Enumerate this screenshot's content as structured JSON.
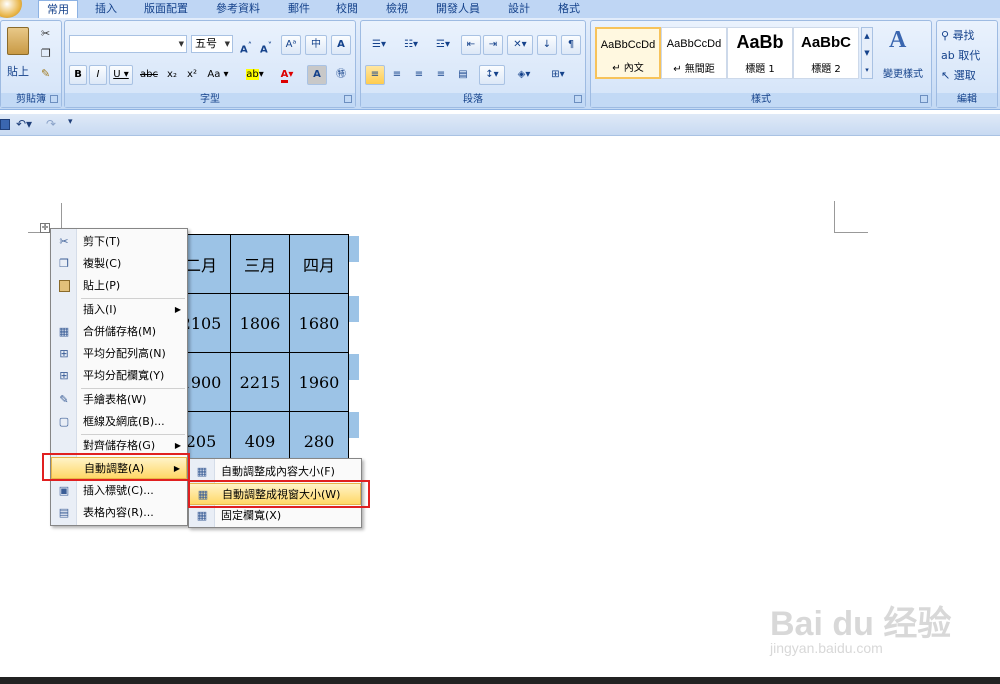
{
  "tabs": [
    "常用",
    "插入",
    "版面配置",
    "參考資料",
    "郵件",
    "校閱",
    "檢視",
    "開發人員",
    "設計",
    "格式"
  ],
  "ribbon": {
    "clipboard": {
      "group": "剪貼簿",
      "paste": "貼上"
    },
    "font": {
      "group": "字型",
      "name_value": "",
      "size_value": "五号"
    },
    "paragraph": {
      "group": "段落"
    },
    "styles": {
      "group": "樣式",
      "items": [
        {
          "preview": "AaBbCcDd",
          "name": "↵ 內文"
        },
        {
          "preview": "AaBbCcDd",
          "name": "↵ 無間距"
        },
        {
          "preview": "AaBb",
          "name": "標題 1"
        },
        {
          "preview": "AaBbC",
          "name": "標題 2"
        }
      ],
      "change_styles": "變更樣式"
    },
    "editing": {
      "group": "編輯",
      "find": "尋找",
      "replace": "取代",
      "select": "選取"
    }
  },
  "table": {
    "headers": [
      "二月",
      "三月",
      "四月"
    ],
    "rows": [
      [
        "2105",
        "1806",
        "1680"
      ],
      [
        "1900",
        "2215",
        "1960"
      ],
      [
        "205",
        "409",
        "280"
      ]
    ]
  },
  "context_menu": {
    "items": [
      {
        "icon": "scissors-icon",
        "glyph": "✂",
        "label": "剪下(T)"
      },
      {
        "icon": "copy-icon",
        "glyph": "❐",
        "label": "複製(C)"
      },
      {
        "icon": "paste-icon",
        "glyph": "📋",
        "label": "貼上(P)"
      },
      {
        "icon": "",
        "glyph": "",
        "label": "插入(I)",
        "submenu": true
      },
      {
        "icon": "merge-cells-icon",
        "glyph": "▦",
        "label": "合併儲存格(M)"
      },
      {
        "icon": "distribute-rows-icon",
        "glyph": "⊞",
        "label": "平均分配列高(N)"
      },
      {
        "icon": "distribute-columns-icon",
        "glyph": "⊞",
        "label": "平均分配欄寬(Y)"
      },
      {
        "icon": "draw-table-icon",
        "glyph": "✎",
        "label": "手繪表格(W)"
      },
      {
        "icon": "borders-icon",
        "glyph": "▢",
        "label": "框線及網底(B)..."
      },
      {
        "icon": "",
        "glyph": "",
        "label": "對齊儲存格(G)",
        "submenu": true
      },
      {
        "icon": "",
        "glyph": "",
        "label": "自動調整(A)",
        "submenu": true
      },
      {
        "icon": "insert-caption-icon",
        "glyph": "▣",
        "label": "插入標號(C)..."
      },
      {
        "icon": "table-properties-icon",
        "glyph": "▤",
        "label": "表格內容(R)..."
      }
    ]
  },
  "submenu": {
    "items": [
      {
        "icon": "autofit-contents-icon",
        "label": "自動調整成內容大小(F)"
      },
      {
        "icon": "autofit-window-icon",
        "label": "自動調整成視窗大小(W)"
      },
      {
        "icon": "fixed-width-icon",
        "label": "固定欄寬(X)"
      }
    ]
  },
  "watermark": {
    "brand": "Bai du 经验",
    "url": "jingyan.baidu.com"
  },
  "colors": {
    "highlight_red": "#e02020",
    "cell_fill": "#9cc3e6"
  }
}
